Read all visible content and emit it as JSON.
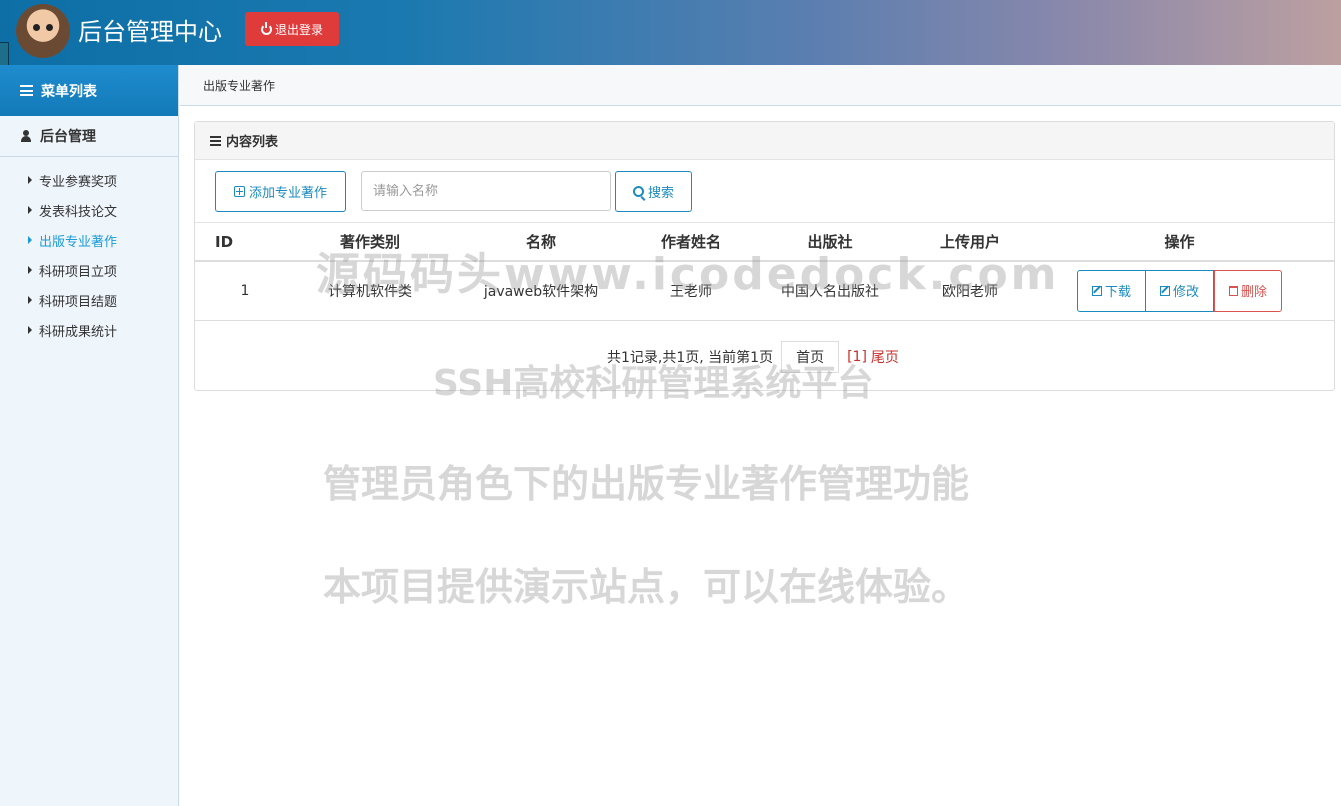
{
  "header": {
    "title": "后台管理中心",
    "logout_label": "退出登录"
  },
  "sidebar": {
    "menu_title": "菜单列表",
    "group_title": "后台管理",
    "items": [
      {
        "label": "专业参赛奖项",
        "active": false
      },
      {
        "label": "发表科技论文",
        "active": false
      },
      {
        "label": "出版专业著作",
        "active": true
      },
      {
        "label": "科研项目立项",
        "active": false
      },
      {
        "label": "科研项目结题",
        "active": false
      },
      {
        "label": "科研成果统计",
        "active": false
      }
    ]
  },
  "breadcrumb": "出版专业著作",
  "panel": {
    "title": "内容列表",
    "add_label": "添加专业著作",
    "search_placeholder": "请输入名称",
    "search_label": "搜索"
  },
  "table": {
    "headers": [
      "ID",
      "著作类别",
      "名称",
      "作者姓名",
      "出版社",
      "上传用户",
      "操作"
    ],
    "rows": [
      {
        "id": "1",
        "category": "计算机软件类",
        "name": "javaweb软件架构",
        "author": "王老师",
        "publisher": "中国人名出版社",
        "uploader": "欧阳老师"
      }
    ],
    "ops": {
      "download": "下载",
      "edit": "修改",
      "delete": "删除"
    }
  },
  "pager": {
    "summary": "共1记录,共1页, 当前第1页",
    "first": "首页",
    "current": "[1]",
    "last": "尾页"
  },
  "watermark": {
    "line1": "源码码头www.icodedock.com",
    "line2": "SSH高校科研管理系统平台",
    "line3": "管理员角色下的出版专业著作管理功能",
    "line4": "本项目提供演示站点，可以在线体验。"
  }
}
